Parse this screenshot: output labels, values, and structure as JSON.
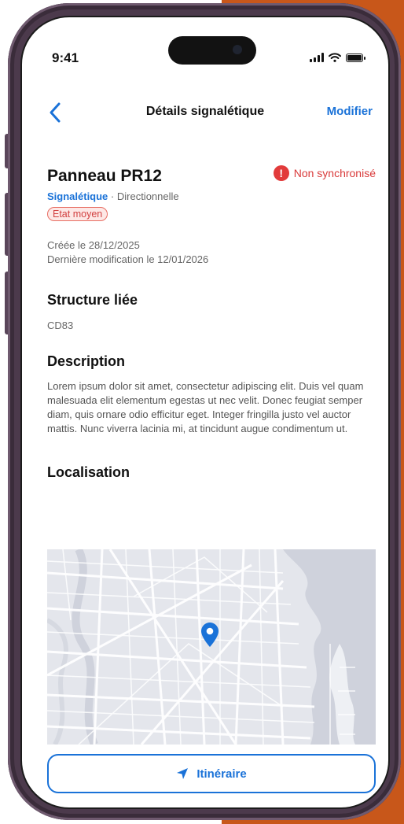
{
  "status_bar": {
    "time": "9:41"
  },
  "nav": {
    "back_icon": "chevron-left-icon",
    "title": "Détails signalétique",
    "action": "Modifier"
  },
  "item": {
    "title": "Panneau PR12",
    "sync_status": "Non synchronisé",
    "category": "Signalétique",
    "separator": " · ",
    "subcategory": "Directionnelle",
    "condition": "Etat moyen",
    "created": "Créée le 28/12/2025",
    "modified": "Dernière modification le 12/01/2026"
  },
  "structure": {
    "title": "Structure liée",
    "value": "CD83"
  },
  "description": {
    "title": "Description",
    "text": "Lorem ipsum dolor sit amet, consectetur adipiscing elit. Duis vel quam malesuada elit elementum egestas ut nec velit. Donec feugiat semper diam, quis ornare odio efficitur eget. Integer fringilla justo vel auctor mattis. Nunc viverra lacinia mi, at tincidunt augue condimentum ut."
  },
  "location": {
    "title": "Localisation",
    "pin_icon": "map-pin-icon"
  },
  "route_button": {
    "label": "Itinéraire",
    "icon": "navigation-arrow-icon"
  },
  "colors": {
    "accent": "#1a72d8",
    "alert": "#e23b3b",
    "badge_bg": "#fde8e6",
    "device_frame": "#4c3a4c",
    "background_accent": "#c8571a"
  }
}
